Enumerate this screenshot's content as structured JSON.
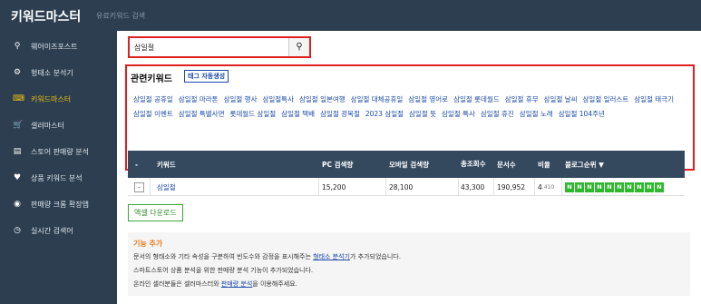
{
  "app": {
    "title": "키워드마스터",
    "subtitle": "유료키워드 검색"
  },
  "sidebar": {
    "items": [
      {
        "icon": "search-icon",
        "label": "웨어이즈포스트"
      },
      {
        "icon": "gear-icon",
        "label": "형태소 분석기"
      },
      {
        "icon": "keyboard-icon",
        "label": "키워드마스터",
        "active": true
      },
      {
        "icon": "cart-icon",
        "label": "셀러마스터"
      },
      {
        "icon": "bar-chart-icon",
        "label": "스토어 판매량 분석"
      },
      {
        "icon": "store-icon",
        "label": "상품 키워드 분석"
      },
      {
        "icon": "chrome-icon",
        "label": "판매량 크롬 확장앱"
      },
      {
        "icon": "clock-icon",
        "label": "실시간 검색어"
      }
    ]
  },
  "search": {
    "value": "삼일절",
    "button_icon": "search-icon"
  },
  "related": {
    "title": "관련키워드",
    "auto_tag_label": "태그 자동생성",
    "keywords": [
      "삼일절 공휴일",
      "삼일절 마라톤",
      "삼일절 행사",
      "삼일절특사",
      "삼일절 일본여행",
      "삼일절 대체공휴일",
      "삼일절 영어로",
      "삼일절 롯데월드",
      "삼일절 휴무",
      "삼일절 날씨",
      "삼일절 일러스트",
      "삼일절 태극기",
      "삼일절 이벤트",
      "삼일절 특별사면",
      "롯데월드 삼일절",
      "삼일절 택배",
      "삼일절 광복절",
      "2023 삼일절",
      "삼일절 뜻",
      "삼일절 특사",
      "삼일절 휴진",
      "삼일절 노래",
      "삼일절 104주년"
    ]
  },
  "table": {
    "headers": [
      "-",
      "키워드",
      "PC 검색량",
      "모바일 검색량",
      "총조회수",
      "문서수",
      "비율",
      "블로그순위 ▼"
    ],
    "rows": [
      {
        "minus": "-",
        "keyword": "삼일절",
        "pc": "15,200",
        "mobile": "28,100",
        "total": "43,300",
        "docs": "190,952",
        "ratio_main": "4",
        "ratio_sub": ".410",
        "ranks": [
          "N",
          "N",
          "N",
          "N",
          "N",
          "N",
          "N",
          "N",
          "N",
          "N"
        ]
      }
    ]
  },
  "excel_label": "엑셀 다운로드",
  "notice": {
    "title": "기능 추가",
    "line1_pre": "문서의 형태소와 기타 속성을 구분하여 빈도수와 감정을 표시해주는 ",
    "line1_link": "형태소 분석기",
    "line1_post": "가 추가되었습니다.",
    "line2": "스마트스토어 상품 분석을 위한 판매량 분석 기능이 추가되었습니다.",
    "line3_pre": "온라인 셀러분들은 셀러마스터와 ",
    "line3_link": "판매량 분석",
    "line3_post": "을 이용해주세요."
  },
  "colors": {
    "sidebar_bg": "#2c3e50",
    "active": "#f1c40f",
    "highlight_border": "#e02020",
    "rank_green": "#2eb82e",
    "link": "#1a4aa8"
  }
}
